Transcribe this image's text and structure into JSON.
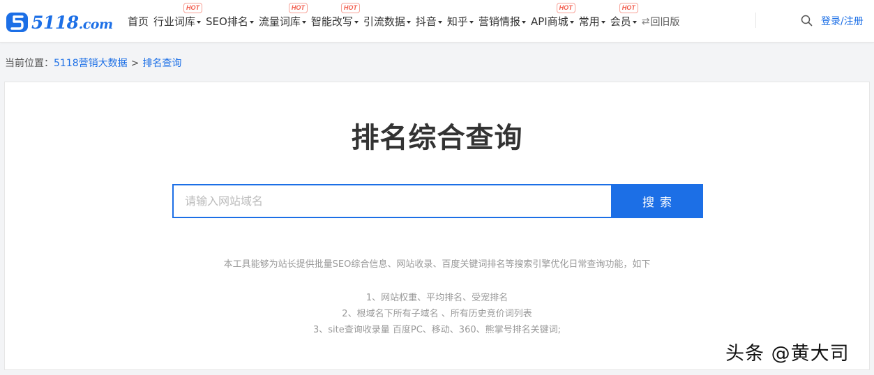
{
  "logo": {
    "brand": "5118",
    "suffix": ".com"
  },
  "nav": {
    "items": [
      {
        "label": "首页",
        "dropdown": false,
        "hot": false
      },
      {
        "label": "行业词库",
        "dropdown": true,
        "hot": true
      },
      {
        "label": "SEO排名",
        "dropdown": true,
        "hot": false
      },
      {
        "label": "流量词库",
        "dropdown": true,
        "hot": true
      },
      {
        "label": "智能改写",
        "dropdown": true,
        "hot": true
      },
      {
        "label": "引流数据",
        "dropdown": true,
        "hot": false
      },
      {
        "label": "抖音",
        "dropdown": true,
        "hot": false
      },
      {
        "label": "知乎",
        "dropdown": true,
        "hot": false
      },
      {
        "label": "营销情报",
        "dropdown": true,
        "hot": false
      },
      {
        "label": "API商城",
        "dropdown": true,
        "hot": true
      },
      {
        "label": "常用",
        "dropdown": true,
        "hot": false
      },
      {
        "label": "会员",
        "dropdown": true,
        "hot": true
      }
    ],
    "hot_label": "HOT",
    "old_version": "回旧版",
    "login": "登录/注册"
  },
  "breadcrumb": {
    "prefix": "当前位置：",
    "home": "5118营销大数据",
    "separator": ">",
    "current": "排名查询"
  },
  "main": {
    "title": "排名综合查询",
    "search": {
      "placeholder": "请输入网站域名",
      "value": "",
      "button": "搜索"
    },
    "description": "本工具能够为站长提供批量SEO综合信息、网站收录、百度关键词排名等搜索引擎优化日常查询功能，如下",
    "features": [
      "1、网站权重、平均排名、受宠排名",
      "2、根域名下所有子域名 、所有历史竞价词列表",
      "3、site查询收录量 百度PC、移动、360、熊掌号排名关键词;"
    ]
  },
  "watermark": "头条 @黄大司",
  "colors": {
    "accent": "#1c6fe6",
    "hot": "#f25a4a"
  }
}
